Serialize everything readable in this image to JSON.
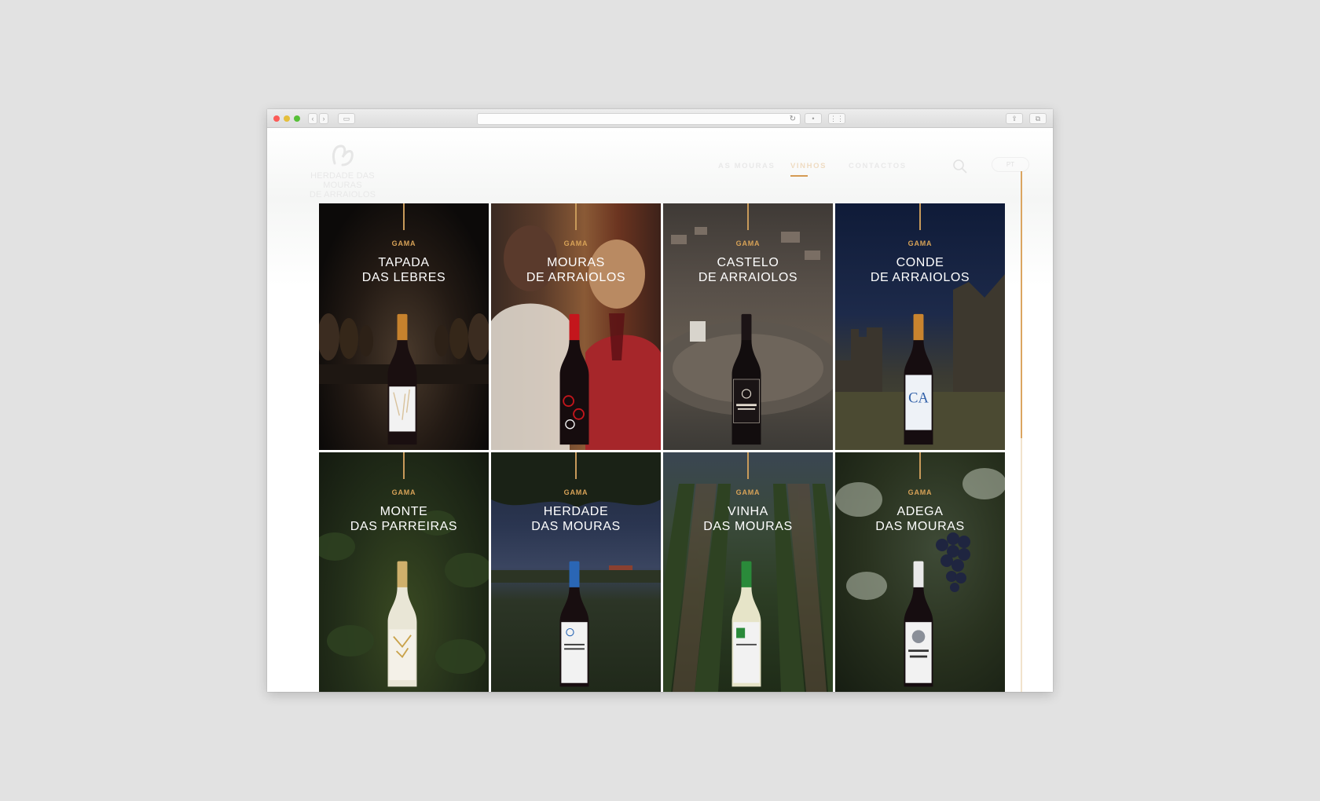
{
  "browser": {
    "title_bar": {
      "buttons": [
        "close",
        "minimize",
        "zoom"
      ]
    },
    "address_bar": {
      "url": ""
    },
    "icons": [
      "back-icon",
      "forward-icon",
      "sidebar-icon",
      "reload-icon",
      "reader-icon",
      "grid-icon",
      "share-icon",
      "tabs-icon"
    ]
  },
  "site": {
    "logo": {
      "line1": "HERDADE DAS MOURAS",
      "line2": "DE ARRAIOLOS"
    },
    "nav": [
      {
        "label": "AS MOURAS",
        "active": false
      },
      {
        "label": "VINHOS",
        "active": true
      },
      {
        "label": "CONTACTOS",
        "active": false
      }
    ],
    "language_button": "PT",
    "accent_color": "#d59b54"
  },
  "ranges": [
    {
      "gama": "GAMA",
      "line1": "TAPADA",
      "line2": "DAS LEBRES",
      "bottle": "red",
      "capsule": "#c7822d",
      "label_color": "#f2f2f2",
      "scene": "cellar"
    },
    {
      "gama": "GAMA",
      "line1": "MOURAS",
      "line2": "DE ARRAIOLOS",
      "bottle": "red",
      "capsule": "#c4161c",
      "label_color": "#1b1414",
      "scene": "couple"
    },
    {
      "gama": "GAMA",
      "line1": "CASTELO",
      "line2": "DE ARRAIOLOS",
      "bottle": "red",
      "capsule": "#1c1416",
      "label_color": "#1a1415",
      "scene": "castle-aerial"
    },
    {
      "gama": "GAMA",
      "line1": "CONDE",
      "line2": "DE ARRAIOLOS",
      "bottle": "red",
      "capsule": "#c9842e",
      "label_color": "#eef2f7",
      "scene": "castle-ruins"
    },
    {
      "gama": "GAMA",
      "line1": "MONTE",
      "line2": "DAS PARREIRAS",
      "bottle": "white",
      "capsule": "#cfb06c",
      "label_color": "#f4f1e8",
      "scene": "vines"
    },
    {
      "gama": "GAMA",
      "line1": "HERDADE",
      "line2": "DAS MOURAS",
      "bottle": "red",
      "capsule": "#2a66b5",
      "label_color": "#f2f2f2",
      "scene": "tree"
    },
    {
      "gama": "GAMA",
      "line1": "VINHA",
      "line2": "DAS MOURAS",
      "bottle": "white",
      "capsule": "#2a8a3a",
      "label_color": "#f2f2f2",
      "scene": "vineyard-rows"
    },
    {
      "gama": "GAMA",
      "line1": "ADEGA",
      "line2": "DAS MOURAS",
      "bottle": "red",
      "capsule": "#e9e9e9",
      "label_color": "#f2f2f2",
      "scene": "grapes"
    }
  ]
}
